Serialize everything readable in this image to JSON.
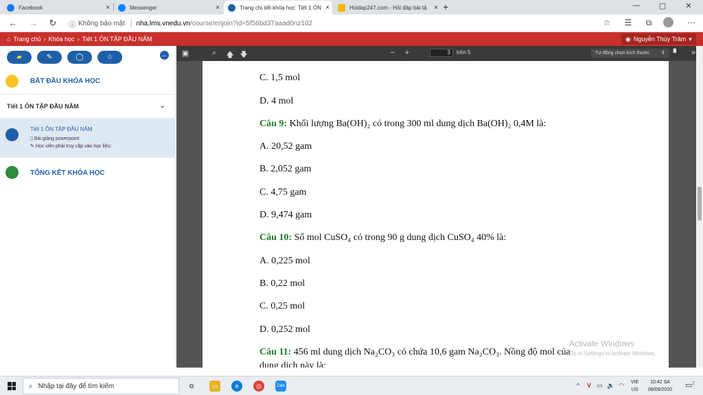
{
  "browser": {
    "tabs": [
      {
        "title": "Facebook",
        "favicon_color": "#1877f2",
        "active": false
      },
      {
        "title": "Messenger",
        "favicon_color": "#0084ff",
        "active": false
      },
      {
        "title": "Trang chi tiết khóa học: Tiết 1 ÔN",
        "favicon_color": "#1f5fa8",
        "active": true
      },
      {
        "title": "Hoidap247.com - Hỏi đáp bài tậ",
        "favicon_color": "#f2b705",
        "active": false
      }
    ],
    "new_tab": "+",
    "window_controls": [
      "—",
      "▢",
      "✕"
    ],
    "security_label": "Không bảo mật",
    "url_host": "nha.lms.vnedu.vn",
    "url_path": "/course/enjoin?id=5f56bd37aaad0nz102",
    "close_glyph": "×"
  },
  "appbar": {
    "breadcrumb": [
      "Trang chủ",
      "Khóa học",
      "Tiết 1 ÔN TẬP ĐẦU NĂM"
    ],
    "user_name": "Nguyễn Thùy Trâm",
    "user_caret": "▾"
  },
  "sidebar": {
    "tool_icons": [
      "▰",
      "✎",
      "◯",
      "☆"
    ],
    "collapse_glyph": "←",
    "start_title": "BẮT ĐẦU KHÓA HỌC",
    "section_title": "Tiết 1 ÔN TẬP ĐẦU NĂM",
    "section_caret": "⌄",
    "lesson_title": "Tiết 1 ÔN TẬP ĐẦU NĂM",
    "lesson_sub1": "Bài giảng powerpoint",
    "lesson_sub2": "Học viên phải truy cập vào học liệu:",
    "end_title": "TỔNG KẾT KHÓA HỌC",
    "colors": {
      "start": "#f7c325",
      "lesson": "#1f5fa8",
      "end": "#2e8b3a",
      "lesson_bg": "#dfe9f3"
    }
  },
  "pdf": {
    "page_current": "3",
    "page_total_label": "trên 5",
    "zoom_minus": "−",
    "zoom_plus": "+",
    "zoom_label": "Tự động chọn kích thước",
    "zoom_caret": "⇕",
    "tools_left": [
      "▣",
      "⌕",
      "🡅",
      "🡇"
    ],
    "tools_right": [
      "▘",
      "»"
    ],
    "lines": [
      {
        "q": "",
        "text": "C. 1,5 mol"
      },
      {
        "q": "",
        "text": "D. 4 mol"
      },
      {
        "q": "Câu 9:",
        "text": " Khối lượng Ba(OH)₂ có trong 300 ml dung dịch Ba(OH)₂ 0,4M là:"
      },
      {
        "q": "",
        "text": "A. 20,52 gam"
      },
      {
        "q": "",
        "text": "B. 2,052 gam"
      },
      {
        "q": "",
        "text": "C. 4,75 gam"
      },
      {
        "q": "",
        "text": "D. 9,474 gam"
      },
      {
        "q": "Câu 10:",
        "text": "  Số mol CuSO₄ có trong 90 g dung dịch CuSO₄ 40% là:"
      },
      {
        "q": "",
        "text": "A. 0,225 mol"
      },
      {
        "q": "",
        "text": "B. 0,22 mol"
      },
      {
        "q": "",
        "text": "C. 0,25 mol"
      },
      {
        "q": "",
        "text": "D. 0,252 mol"
      },
      {
        "q": "Câu 11:",
        "text": "  456 ml dung dịch Na₂CO₃ có chứa 10,6 gam Na₂CO₃. Nồng độ mol của"
      },
      {
        "q": "",
        "text": "dung dịch này là:"
      }
    ],
    "watermark_title": "Activate Windows",
    "watermark_sub": "Go to Settings to activate Windows."
  },
  "taskbar": {
    "search_placeholder": "Nhập tại đây để tìm kiếm",
    "lang_top": "VIE",
    "lang_bottom": "US",
    "time": "10:42 SA",
    "date": "08/09/2020",
    "notif_count": "2",
    "tray_icons": [
      "^",
      "V",
      "▭",
      "🔈",
      "◠"
    ],
    "zalo_label": "Zalo"
  }
}
